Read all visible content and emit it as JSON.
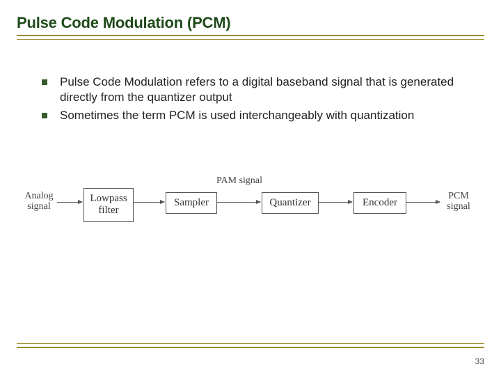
{
  "title": "Pulse Code Modulation (PCM)",
  "bullets": [
    "Pulse Code Modulation refers to a digital baseband signal that is generated directly from the quantizer output",
    "Sometimes the term PCM is used interchangeably with quantization"
  ],
  "diagram": {
    "input_label": "Analog\nsignal",
    "pam_label": "PAM signal",
    "output_label": "PCM\nsignal",
    "blocks": [
      "Lowpass\nfilter",
      "Sampler",
      "Quantizer",
      "Encoder"
    ]
  },
  "page_number": "33"
}
